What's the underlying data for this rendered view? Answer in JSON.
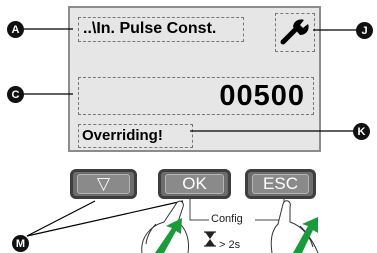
{
  "screen": {
    "title": "..\\In. Pulse Const.",
    "value": "00500",
    "status": "Overriding!",
    "icon": "wrench-icon"
  },
  "buttons": [
    {
      "label": "▽"
    },
    {
      "label": "OK"
    },
    {
      "label": "ESC"
    }
  ],
  "callouts": {
    "a": "A",
    "c": "C",
    "j": "J",
    "k": "K",
    "m": "M"
  },
  "gesture": {
    "label": "Config",
    "duration": "> 2s",
    "hourglass_icon": "hourglass-icon"
  }
}
